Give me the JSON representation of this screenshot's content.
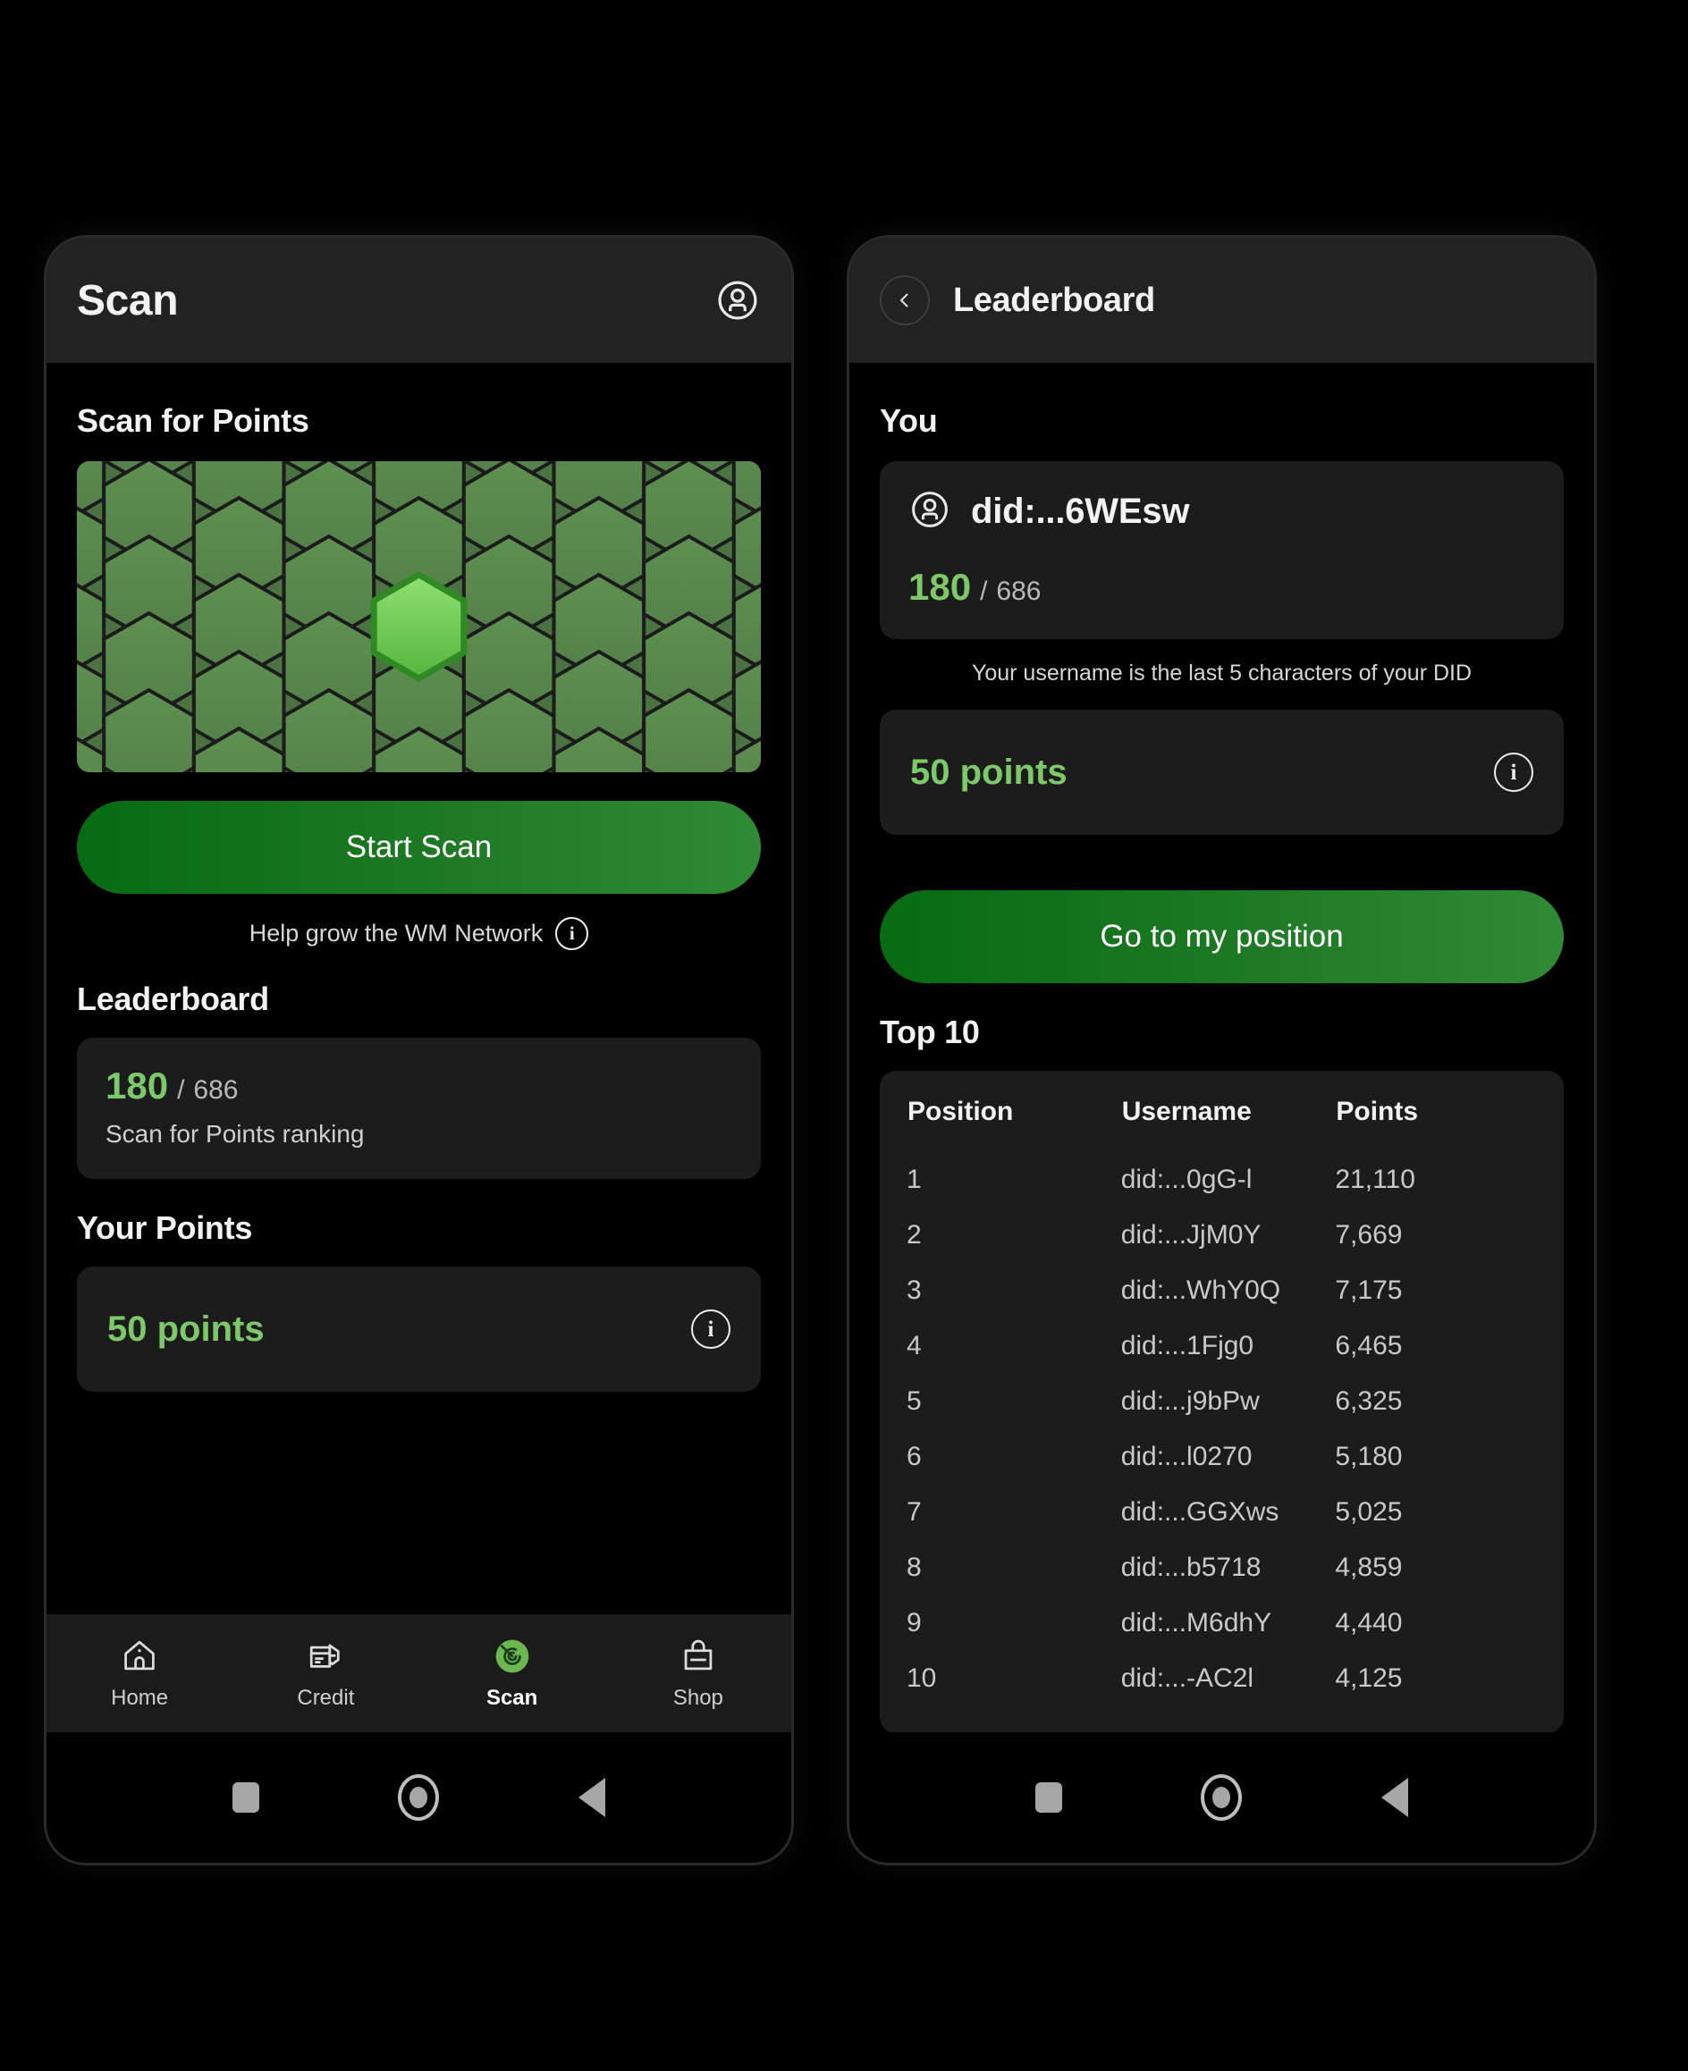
{
  "left_phone": {
    "appbar": {
      "title": "Scan",
      "profile_icon": "account-circle-icon"
    },
    "scan_section": {
      "heading": "Scan for Points",
      "hex_grid_icon": "honeycomb-hex-grid",
      "start_button": "Start Scan",
      "hint": "Help grow the WM Network",
      "hint_info_icon": "info-icon"
    },
    "leaderboard_section": {
      "heading": "Leaderboard",
      "rank": "180",
      "separator": "/",
      "total": "686",
      "subtitle": "Scan for Points ranking"
    },
    "points_section": {
      "heading": "Your Points",
      "value": "50 points",
      "info_icon": "info-icon"
    },
    "bottom_nav": [
      {
        "label": "Home",
        "icon": "home-icon",
        "active": false
      },
      {
        "label": "Credit",
        "icon": "credit-card-pen-icon",
        "active": false
      },
      {
        "label": "Scan",
        "icon": "radar-scan-icon",
        "active": true
      },
      {
        "label": "Shop",
        "icon": "shopping-bag-icon",
        "active": false
      }
    ],
    "system_bar": {
      "recents": "square-icon",
      "home": "circle-icon",
      "back": "triangle-back-icon"
    }
  },
  "right_phone": {
    "appbar": {
      "back_icon": "chevron-left-circle-icon",
      "title": "Leaderboard"
    },
    "you_section": {
      "heading": "You",
      "avatar_icon": "account-circle-icon",
      "did": "did:...6WEsw",
      "rank": "180",
      "separator": "/",
      "total": "686",
      "username_hint": "Your username is the last 5 characters of your DID"
    },
    "points_section": {
      "value": "50 points",
      "info_icon": "info-icon"
    },
    "go_button": "Go to my position",
    "top10": {
      "heading": "Top 10",
      "columns": [
        "Position",
        "Username",
        "Points"
      ],
      "rows": [
        {
          "position": "1",
          "username": "did:...0gG-l",
          "points": "21,110"
        },
        {
          "position": "2",
          "username": "did:...JjM0Y",
          "points": "7,669"
        },
        {
          "position": "3",
          "username": "did:...WhY0Q",
          "points": "7,175"
        },
        {
          "position": "4",
          "username": "did:...1Fjg0",
          "points": "6,465"
        },
        {
          "position": "5",
          "username": "did:...j9bPw",
          "points": "6,325"
        },
        {
          "position": "6",
          "username": "did:...l0270",
          "points": "5,180"
        },
        {
          "position": "7",
          "username": "did:...GGXws",
          "points": "5,025"
        },
        {
          "position": "8",
          "username": "did:...b5718",
          "points": "4,859"
        },
        {
          "position": "9",
          "username": "did:...M6dhY",
          "points": "4,440"
        },
        {
          "position": "10",
          "username": "did:...-AC2l",
          "points": "4,125"
        }
      ]
    },
    "system_bar": {
      "recents": "square-icon",
      "home": "circle-icon",
      "back": "triangle-back-icon"
    }
  },
  "colors": {
    "accent_green": "#7dc96a",
    "button_green_start": "#076b12",
    "button_green_end": "#2e8b33",
    "hex_base": "#5b8c4f",
    "hex_highlight": "#6fc356",
    "card_bg": "#1c1c1c",
    "appbar_bg": "#222222",
    "screen_bg": "#000000"
  }
}
